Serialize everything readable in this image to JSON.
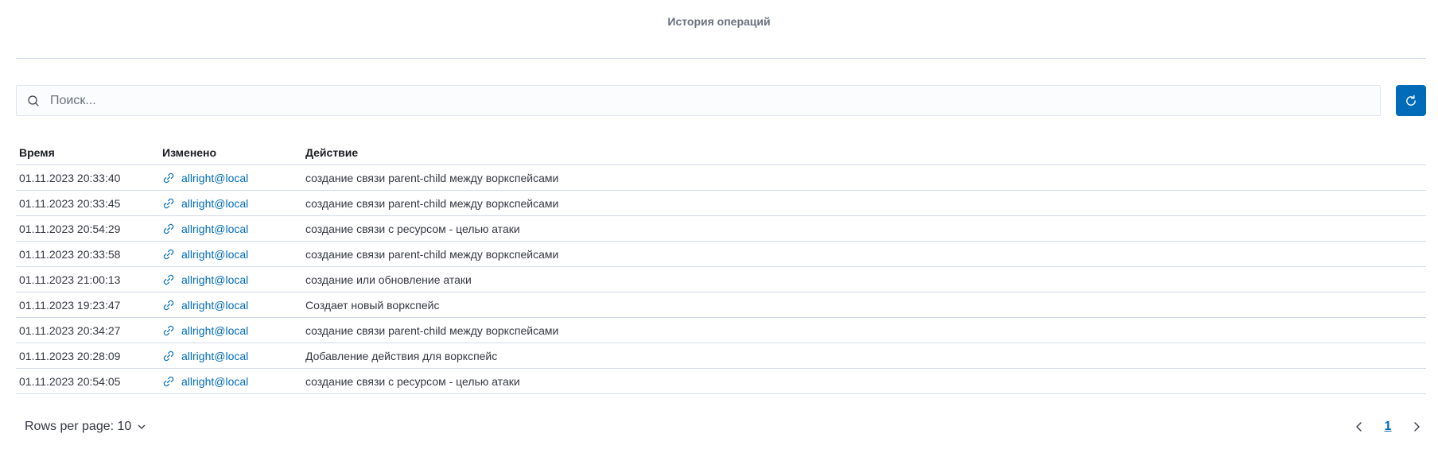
{
  "header": {
    "title": "История операций"
  },
  "search": {
    "placeholder": "Поиск...",
    "value": ""
  },
  "table": {
    "columns": {
      "time": "Время",
      "user": "Изменено",
      "action": "Действие"
    },
    "rows": [
      {
        "time": "01.11.2023 20:33:40",
        "user": "allright@local",
        "action": "создание связи parent-child между воркспейсами"
      },
      {
        "time": "01.11.2023 20:33:45",
        "user": "allright@local",
        "action": "создание связи parent-child между воркспейсами"
      },
      {
        "time": "01.11.2023 20:54:29",
        "user": "allright@local",
        "action": "создание связи с ресурсом - целью атаки"
      },
      {
        "time": "01.11.2023 20:33:58",
        "user": "allright@local",
        "action": "создание связи parent-child между воркспейсами"
      },
      {
        "time": "01.11.2023 21:00:13",
        "user": "allright@local",
        "action": "создание или обновление атаки"
      },
      {
        "time": "01.11.2023 19:23:47",
        "user": "allright@local",
        "action": "Создает новый воркспейс"
      },
      {
        "time": "01.11.2023 20:34:27",
        "user": "allright@local",
        "action": "создание связи parent-child между воркспейсами"
      },
      {
        "time": "01.11.2023 20:28:09",
        "user": "allright@local",
        "action": "Добавление действия для воркспейс"
      },
      {
        "time": "01.11.2023 20:54:05",
        "user": "allright@local",
        "action": "создание связи с ресурсом - целью атаки"
      }
    ]
  },
  "pagination": {
    "rows_per_page_label": "Rows per page: 10",
    "current_page": "1"
  },
  "icons": {
    "search": "search-icon",
    "refresh": "refresh-icon",
    "link": "link-icon",
    "chevron_down": "chevron-down-icon",
    "prev": "chevron-left-icon",
    "next": "chevron-right-icon"
  },
  "colors": {
    "accent": "#006bb8",
    "border": "#d3dae6",
    "title": "#69707d",
    "text": "#343741"
  }
}
